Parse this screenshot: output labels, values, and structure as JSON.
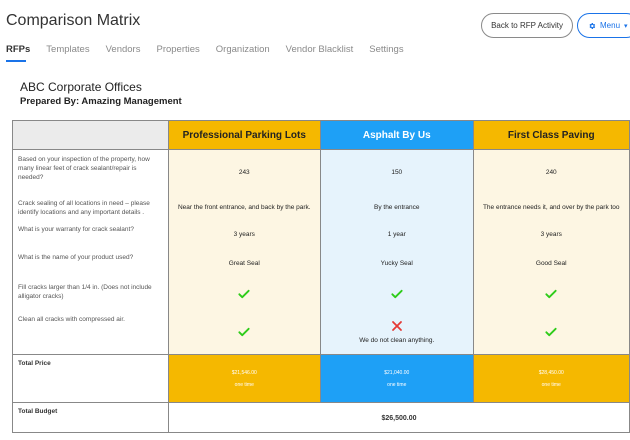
{
  "header": {
    "title": "Comparison Matrix",
    "back_button": "Back to RFP Activity",
    "menu_button": "Menu"
  },
  "tabs": [
    {
      "label": "RFPs",
      "active": true
    },
    {
      "label": "Templates",
      "active": false
    },
    {
      "label": "Vendors",
      "active": false
    },
    {
      "label": "Properties",
      "active": false
    },
    {
      "label": "Organization",
      "active": false
    },
    {
      "label": "Vendor Blacklist",
      "active": false
    },
    {
      "label": "Settings",
      "active": false
    }
  ],
  "rfp": {
    "org_name": "ABC Corporate Offices",
    "prepared_by": "Prepared By: Amazing Management"
  },
  "vendors": [
    {
      "name": "Professional Parking Lots",
      "color": "#f5b800"
    },
    {
      "name": "Asphalt By Us",
      "color": "#1ea0f6"
    },
    {
      "name": "First Class Paving",
      "color": "#f5b800"
    }
  ],
  "questions": [
    {
      "text": "Based on your inspection of the property, how many linear feet of crack sealant/repair is needed?",
      "answers": [
        {
          "type": "text",
          "value": "243"
        },
        {
          "type": "text",
          "value": "150"
        },
        {
          "type": "text",
          "value": "240"
        }
      ]
    },
    {
      "text": "Crack sealing of all locations in need – please identify locations and any important details .",
      "answers": [
        {
          "type": "text",
          "value": "Near the front entrance, and back by the park."
        },
        {
          "type": "text",
          "value": "By the entrance"
        },
        {
          "type": "text",
          "value": "The entrance needs it, and over by the park too"
        }
      ]
    },
    {
      "text": "What is your warranty for crack sealant?",
      "answers": [
        {
          "type": "text",
          "value": "3 years"
        },
        {
          "type": "text",
          "value": "1 year"
        },
        {
          "type": "text",
          "value": "3 years"
        }
      ]
    },
    {
      "text": "What is the name of your product used?",
      "answers": [
        {
          "type": "text",
          "value": "Great Seal"
        },
        {
          "type": "text",
          "value": "Yucky Seal"
        },
        {
          "type": "text",
          "value": "Good Seal"
        }
      ]
    },
    {
      "text": "Fill cracks larger than 1/4 in. (Does not include alligator cracks)",
      "answers": [
        {
          "type": "check"
        },
        {
          "type": "check"
        },
        {
          "type": "check"
        }
      ]
    },
    {
      "text": "Clean all cracks with compressed air.",
      "answers": [
        {
          "type": "check"
        },
        {
          "type": "x",
          "note": "We do not clean anything."
        },
        {
          "type": "check"
        }
      ]
    }
  ],
  "totals": {
    "label": "Total Price",
    "prices": [
      {
        "amount": "$21,546.00",
        "term": "one time"
      },
      {
        "amount": "$21,040.00",
        "term": "one time"
      },
      {
        "amount": "$28,450.00",
        "term": "one time"
      }
    ]
  },
  "budget": {
    "label": "Total Budget",
    "value": "$26,500.00"
  },
  "icons": {
    "check": "check-icon",
    "x": "x-icon",
    "gear": "gear-icon",
    "caret": "chevron-down-icon"
  },
  "colors": {
    "check": "#2ecc1a",
    "x": "#e53935",
    "accent": "#1a73e8"
  }
}
